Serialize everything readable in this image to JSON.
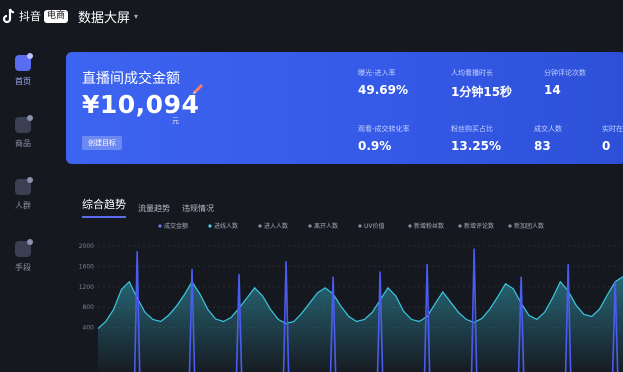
{
  "topbar": {
    "brand": "抖音",
    "badge": "电商",
    "title": "数据大屏"
  },
  "sidebar": {
    "items": [
      {
        "label": "首页",
        "active": true
      },
      {
        "label": "商品",
        "active": false
      },
      {
        "label": "人群",
        "active": false
      },
      {
        "label": "手段",
        "active": false
      }
    ]
  },
  "hero": {
    "title": "直播间成交金额",
    "value": "¥10,094",
    "unit": "元",
    "button": "创建目标",
    "metrics": [
      {
        "label": "曝光-进入率",
        "value": "49.69%"
      },
      {
        "label": "人均看播时长",
        "value": "1分钟15秒"
      },
      {
        "label": "分钟评论次数",
        "value": "14"
      },
      {
        "label": "观看-成交转化率",
        "value": "0.9%"
      },
      {
        "label": "粉丝购买占比",
        "value": "13.25%"
      },
      {
        "label": "成交人数",
        "value": "83"
      },
      {
        "label": "实时在",
        "value": "0"
      }
    ]
  },
  "tabs": [
    {
      "label": "综合趋势",
      "active": true
    },
    {
      "label": "流量趋势",
      "active": false
    },
    {
      "label": "违规情况",
      "active": false
    }
  ],
  "chart_data": {
    "type": "line",
    "legend": [
      "成交金额",
      "进线人数",
      "进入人数",
      "离开人数",
      "UV价值",
      "新增粉丝数",
      "新增评论数",
      "新加团人数"
    ],
    "legend_colors": [
      "#6a7df0",
      "#4fd0e6",
      "#8a8fa3",
      "#8a8fa3",
      "#8a8fa3",
      "#8a8fa3",
      "#8a8fa3",
      "#8a8fa3"
    ],
    "yticks": [
      2000,
      1600,
      1200,
      800,
      400
    ],
    "ylim": [
      0,
      2000
    ],
    "series": [
      {
        "color": "#3bc8e0",
        "values": [
          380,
          520,
          760,
          1150,
          1300,
          980,
          700,
          560,
          520,
          640,
          820,
          1040,
          1300,
          1060,
          760,
          570,
          520,
          600,
          780,
          980,
          1180,
          1020,
          760,
          560,
          480,
          520,
          680,
          880,
          1080,
          1180,
          1060,
          820,
          620,
          520,
          560,
          700,
          940,
          1180,
          1020,
          720,
          560,
          520,
          620,
          860,
          1100,
          900,
          700,
          560,
          500,
          580,
          760,
          1000,
          1260,
          1160,
          880,
          640,
          560,
          700,
          980,
          1300,
          1120,
          840,
          660,
          620,
          760,
          1040,
          1300,
          1400
        ]
      },
      {
        "color": "#4b5cf0",
        "spikes": [
          {
            "i": 5,
            "v": 0
          },
          {
            "i": 12,
            "v": 0
          },
          {
            "i": 18,
            "v": 0
          },
          {
            "i": 24,
            "v": 0
          },
          {
            "i": 30,
            "v": 0
          },
          {
            "i": 36,
            "v": 0
          },
          {
            "i": 42,
            "v": 0
          },
          {
            "i": 48,
            "v": 0
          },
          {
            "i": 54,
            "v": 0
          },
          {
            "i": 60,
            "v": 0
          },
          {
            "i": 66,
            "v": 0
          }
        ],
        "peaks": [
          1900,
          1550,
          1450,
          1700,
          1400,
          1500,
          1650,
          1950,
          1400,
          1650,
          1300
        ]
      }
    ]
  },
  "colors": {
    "accent": "#3d64f0",
    "background": "#16181f",
    "line_primary": "#3bc8e0",
    "line_secondary": "#4b5cf0"
  },
  "icons": {
    "logo": "douyin-note-icon",
    "pen": "pencil-icon"
  }
}
